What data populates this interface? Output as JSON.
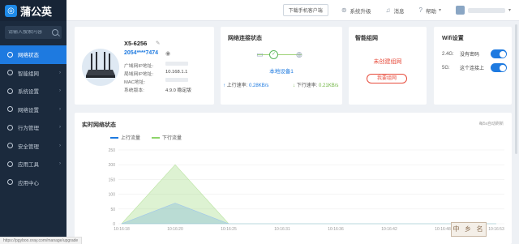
{
  "app": {
    "logo_text": "蒲公英"
  },
  "sidebar": {
    "search_placeholder": "请输入搜索内容",
    "items": [
      {
        "label": "网络状态"
      },
      {
        "label": "智能组网"
      },
      {
        "label": "系统设置"
      },
      {
        "label": "网络设置"
      },
      {
        "label": "行为管理"
      },
      {
        "label": "安全管理"
      },
      {
        "label": "应用工具"
      },
      {
        "label": "应用中心"
      }
    ]
  },
  "topbar": {
    "download_label": "下载手机客户端",
    "upgrade_label": "系统升级",
    "messages_label": "消息",
    "help_label": "帮助"
  },
  "device": {
    "model": "X5-6256",
    "sn": "2054****7474",
    "fields": [
      {
        "label": "广域网IP地址:",
        "value": ""
      },
      {
        "label": "局域网IP地址:",
        "value": "10.168.1.1"
      },
      {
        "label": "MAC地址:",
        "value": ""
      },
      {
        "label": "系统版本:",
        "value": "4.9.0 稳定版"
      }
    ]
  },
  "network": {
    "title": "网络连接状态",
    "local_label": "本地设备1",
    "up_label": "上行速率:",
    "up_value": "0.28KB/s",
    "down_label": "下行速率:",
    "down_value": "0.21KB/s"
  },
  "smart": {
    "title": "智能组网",
    "status": "未创建组网",
    "button_label": "我要组网"
  },
  "wifi": {
    "title": "Wifi设置",
    "rows": [
      {
        "band": "2.4G:",
        "name": "没有密码",
        "enabled": true
      },
      {
        "band": "5G:",
        "name": "这个连接上",
        "enabled": true
      }
    ]
  },
  "realtime": {
    "title": "实时网络状态",
    "link_label": "每5s自动刷新"
  },
  "watermark": "中 乡 名",
  "status_url": "https://pgyboo.oray.com/manage/upgrade",
  "colors": {
    "accent": "#1e7ae0",
    "up": "#1e7ae0",
    "down": "#8dd46a",
    "sidebar": "#1b2a3d"
  },
  "chart_data": {
    "type": "area",
    "x": [
      "10:16:18",
      "10:16:20",
      "10:16:25",
      "10:16:31",
      "10:16:36",
      "10:16:42",
      "10:16:48",
      "10:16:53"
    ],
    "series": [
      {
        "name": "上行流量",
        "values": [
          0,
          70,
          0,
          0,
          0,
          0,
          0,
          0
        ]
      },
      {
        "name": "下行流量",
        "values": [
          0,
          200,
          0,
          0,
          0,
          0,
          0,
          0
        ]
      }
    ],
    "yticks": [
      0,
      50,
      100,
      150,
      200,
      250
    ],
    "ylim": [
      0,
      250
    ],
    "legend": "top-left",
    "grid": true
  }
}
